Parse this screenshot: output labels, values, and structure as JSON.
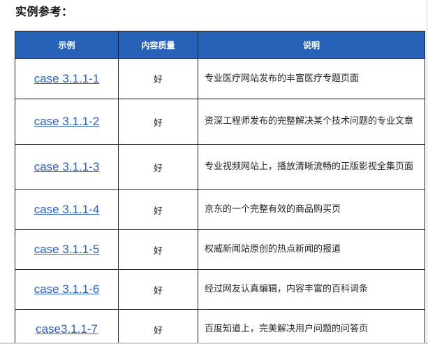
{
  "heading": "实例参考：",
  "table": {
    "headers": [
      "示例",
      "内容质量",
      "说明"
    ],
    "rows": [
      {
        "example": "case 3.1.1-1",
        "quality": "好",
        "description": "专业医疗网站发布的丰富医疗专题页面"
      },
      {
        "example": "case 3.1.1-2",
        "quality": "好",
        "description": "资深工程师发布的完整解决某个技术问题的专业文章"
      },
      {
        "example": "case 3.1.1-3",
        "quality": "好",
        "description": "专业视频网站上，播放清晰流畅的正版影视全集页面"
      },
      {
        "example": "case 3.1.1-4",
        "quality": "好",
        "description": "京东的一个完整有效的商品购买页"
      },
      {
        "example": "case 3.1.1-5",
        "quality": "好",
        "description": "权威新闻站原创的热点新闻的报道"
      },
      {
        "example": "case 3.1.1-6",
        "quality": "好",
        "description": "经过网友认真编辑，内容丰富的百科词条"
      },
      {
        "example": "case3.1.1-7",
        "quality": "好",
        "description": "百度知道上，完美解决用户问题的问答页"
      }
    ]
  },
  "colors": {
    "header_bg": "#2762b8",
    "header_text": "#ffffff",
    "link": "#2a5fc8",
    "border": "#1f1f1f"
  }
}
